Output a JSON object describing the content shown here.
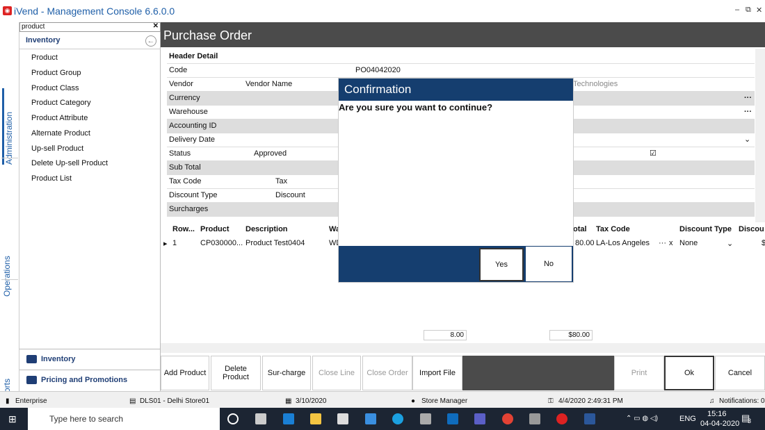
{
  "app": {
    "title": "iVend - Management Console  6.6.0.0",
    "icon_color": "#d22222",
    "window_buttons": [
      "–",
      "⧉",
      "✕"
    ]
  },
  "leftrail": {
    "tabs": [
      "Administration",
      "Operations",
      "Reports"
    ]
  },
  "sidebar": {
    "search_value": "product",
    "section_title": "Inventory",
    "items": [
      {
        "label": "Product"
      },
      {
        "label": "Product Group"
      },
      {
        "label": "Product Class"
      },
      {
        "label": "Product Category"
      },
      {
        "label": "Product Attribute"
      },
      {
        "label": "Alternate Product"
      },
      {
        "label": "Up-sell Product"
      },
      {
        "label": "Delete Up-sell Product"
      },
      {
        "label": "Product List"
      }
    ],
    "modules": [
      {
        "label": "Inventory"
      },
      {
        "label": "Pricing and Promotions"
      }
    ]
  },
  "page": {
    "title": "Purchase Order"
  },
  "form": {
    "section": "Header Detail",
    "code_label": "Code",
    "code_value": "PO04042020",
    "vendor_label": "Vendor",
    "vendor_name_label": "Vendor Name",
    "vendor_name_value": "Technologies",
    "currency_label": "Currency",
    "warehouse_label": "Warehouse",
    "accounting_label": "Accounting ID",
    "delivery_label": "Delivery Date",
    "status_label": "Status",
    "status_value": "Approved",
    "subtotal_label": "Sub Total",
    "taxcode_label": "Tax Code",
    "tax_label": "Tax",
    "discount_type_label": "Discount Type",
    "discount_label": "Discount",
    "surcharges_label": "Surcharges"
  },
  "grid": {
    "headers": [
      "Row...",
      "Product",
      "Description",
      "Wa",
      "otal",
      "Tax Code",
      "Discount Type",
      "Discou"
    ],
    "row": {
      "row_no": "1",
      "product": "CP030000...",
      "description": "Product Test0404",
      "warehouse": "WD",
      "total": "80.00",
      "tax_code": "LA-Los Angeles",
      "discount_type": "None",
      "discount": "$"
    },
    "total_qty": "8.00",
    "total_amount": "$80.00"
  },
  "buttons": [
    {
      "label": "Add  Product"
    },
    {
      "label": "Delete Product"
    },
    {
      "label": "Sur-charge"
    },
    {
      "label": "Close Line"
    },
    {
      "label": "Close Order"
    },
    {
      "label": "Import File"
    },
    {
      "label": "Print"
    },
    {
      "label": "Ok"
    },
    {
      "label": "Cancel"
    }
  ],
  "status": {
    "edition": "Enterprise",
    "store": "DLS01 - Delhi Store01",
    "date": "3/10/2020",
    "user": "Store Manager",
    "datetime": "4/4/2020 2:49:31 PM",
    "notifications": "Notifications: 0"
  },
  "taskbar": {
    "search_placeholder": "Type here to search",
    "lang": "ENG",
    "time": "15:16",
    "date": "04-04-2020",
    "notif_count": "3"
  },
  "modal": {
    "title": "Confirmation",
    "message": "Are you sure you want to continue?",
    "yes_label": "Yes",
    "no_label": "No",
    "color": "#153e6f"
  }
}
